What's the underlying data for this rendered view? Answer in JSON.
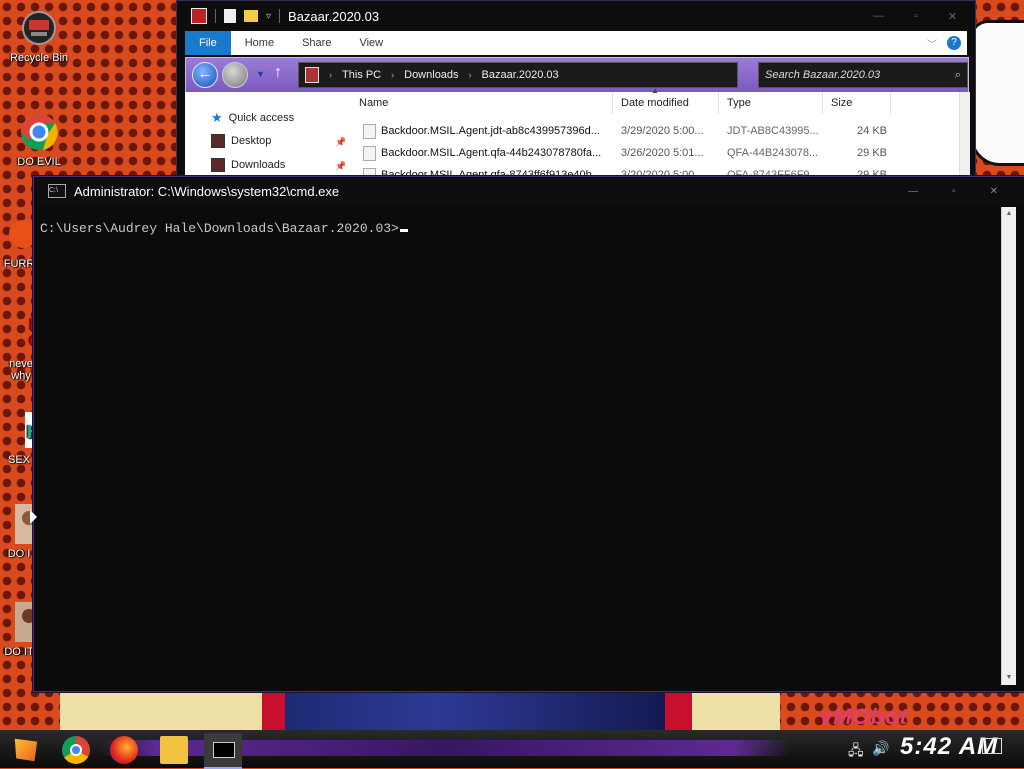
{
  "desktop": {
    "icons": [
      {
        "label": "Recycle Bin"
      },
      {
        "label": "DO EVIL"
      },
      {
        "label": "FURR"
      },
      {
        "label": "neve\nwhy"
      },
      {
        "label": "SEX"
      },
      {
        "label": "DO I"
      },
      {
        "label": "DO IT"
      }
    ],
    "brand_text": "vMObot"
  },
  "explorer": {
    "title": "Bazaar.2020.03",
    "ribbon_tabs": [
      "File",
      "Home",
      "Share",
      "View"
    ],
    "breadcrumb": [
      "This PC",
      "Downloads",
      "Bazaar.2020.03"
    ],
    "search_placeholder": "Search Bazaar.2020.03",
    "nav_items": [
      "Quick access",
      "Desktop",
      "Downloads"
    ],
    "columns": [
      "Name",
      "Date modified",
      "Type",
      "Size"
    ],
    "files": [
      {
        "name": "Backdoor.MSIL.Agent.jdt-ab8c439957396d...",
        "date": "3/29/2020 5:00...",
        "type": "JDT-AB8C43995...",
        "size": "24 KB"
      },
      {
        "name": "Backdoor.MSIL.Agent.qfa-44b243078780fa...",
        "date": "3/26/2020 5:01...",
        "type": "QFA-44B243078...",
        "size": "29 KB"
      },
      {
        "name": "Backdoor.MSIL.Agent.qfa-8743ff6f913e40b...",
        "date": "3/20/2020 5:00...",
        "type": "QFA-8743FF6F9...",
        "size": "29 KB"
      }
    ]
  },
  "cmd": {
    "title": "Administrator: C:\\Windows\\system32\\cmd.exe",
    "prompt": "C:\\Users\\Audrey Hale\\Downloads\\Bazaar.2020.03>"
  },
  "taskbar": {
    "clock": "5:42 AM"
  }
}
